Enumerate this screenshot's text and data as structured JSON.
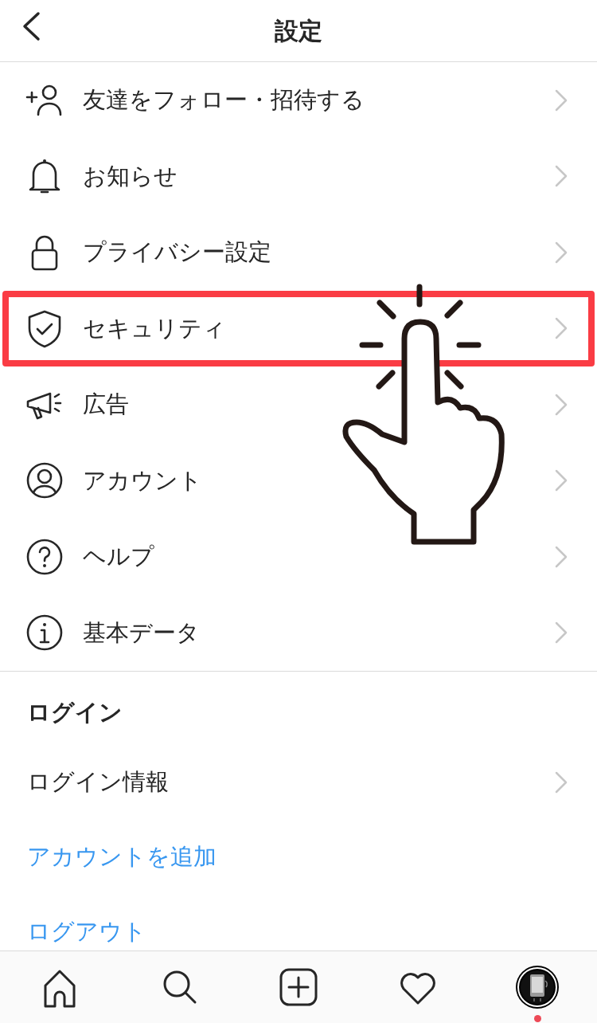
{
  "header": {
    "title": "設定"
  },
  "menu_items": [
    {
      "label": "友達をフォロー・招待する",
      "highlighted": false
    },
    {
      "label": "お知らせ",
      "highlighted": false
    },
    {
      "label": "プライバシー設定",
      "highlighted": false
    },
    {
      "label": "セキュリティ",
      "highlighted": true
    },
    {
      "label": "広告",
      "highlighted": false
    },
    {
      "label": "アカウント",
      "highlighted": false
    },
    {
      "label": "ヘルプ",
      "highlighted": false
    },
    {
      "label": "基本データ",
      "highlighted": false
    }
  ],
  "login_section": {
    "heading": "ログイン",
    "items": [
      {
        "label": "ログイン情報",
        "kind": "nav"
      },
      {
        "label": "アカウントを追加",
        "kind": "link"
      },
      {
        "label": "ログアウト",
        "kind": "link"
      }
    ]
  },
  "bottom_nav": {
    "profile_notification": true
  }
}
